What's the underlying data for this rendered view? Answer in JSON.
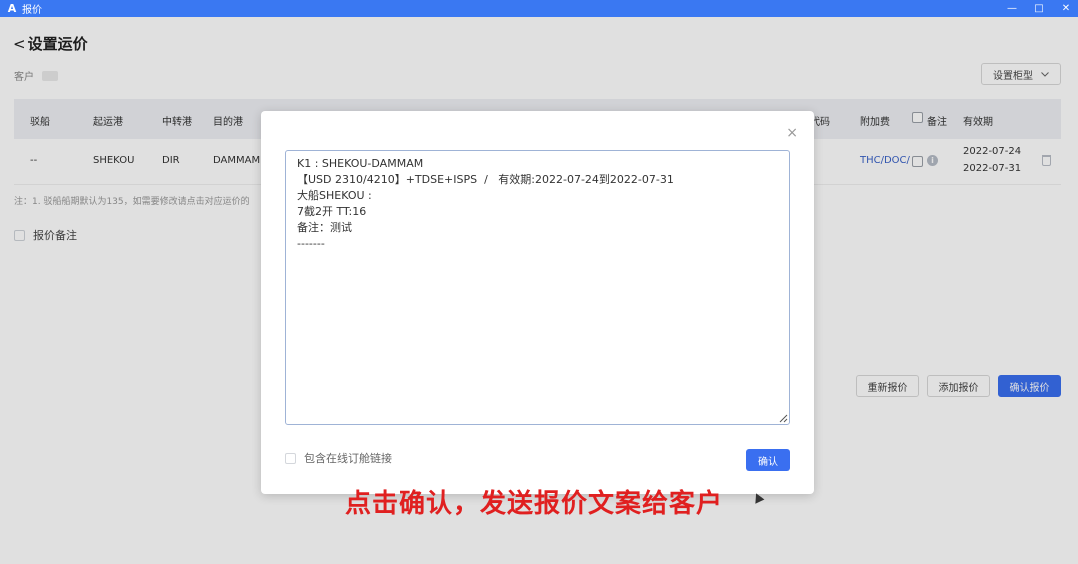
{
  "window": {
    "title": "报价",
    "logo": "A",
    "controls": [
      "—",
      "□",
      "✕"
    ]
  },
  "page": {
    "back_glyph": "<",
    "title": "设置运价",
    "customer_label": "客户",
    "set_box_type_label": "设置柜型",
    "table": {
      "headers": {
        "barge": "驳船",
        "pol": "起运港",
        "transit": "中转港",
        "pod": "目的港",
        "code": "代码",
        "surcharge": "附加费",
        "remark": "备注",
        "validity": "有效期"
      },
      "row": {
        "barge": "--",
        "pol": "SHEKOU",
        "transit": "DIR",
        "pod": "DAMMAM",
        "surcharge": "THC/DOC/",
        "valid_from": "2022-07-24",
        "valid_to": "2022-07-31"
      }
    },
    "note": "注：1. 驳船船期默认为135，如需要修改请点击对应运价的",
    "quote_remark_label": "报价备注",
    "actions": {
      "reset": "重新报价",
      "add": "添加报价",
      "confirm": "确认报价"
    }
  },
  "modal": {
    "close_glyph": "×",
    "content": "K1 : SHEKOU-DAMMAM\n【USD 2310/4210】+TDSE+ISPS  /   有效期:2022-07-24到2022-07-31\n大船SHEKOU :\n7截2开 TT:16\n备注：测试\n-------",
    "online_link_label": "包含在线订舱链接",
    "confirm_label": "确认"
  },
  "caption": "点击确认，发送报价文案给客户"
}
